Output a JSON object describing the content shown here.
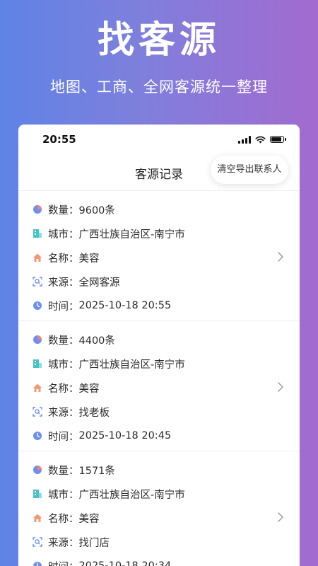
{
  "hero": {
    "title": "找客源",
    "subtitle": "地图、工商、全网客源统一整理"
  },
  "status": {
    "time": "20:55"
  },
  "nav": {
    "title": "客源记录",
    "clear_export_label": "清空导出联系人"
  },
  "labels": {
    "count": "数量：",
    "city": "城市：",
    "name": "名称：",
    "source": "来源：",
    "time": "时间："
  },
  "records": [
    {
      "count": "9600条",
      "city": "广西壮族自治区-南宁市",
      "name": "美容",
      "source": "全网客源",
      "time": "2025-10-18 20:55"
    },
    {
      "count": "4400条",
      "city": "广西壮族自治区-南宁市",
      "name": "美容",
      "source": "找老板",
      "time": "2025-10-18 20:45"
    },
    {
      "count": "1571条",
      "city": "广西壮族自治区-南宁市",
      "name": "美容",
      "source": "找门店",
      "time": "2025-10-18 20:34"
    }
  ],
  "icons": {
    "count": "pie-chart-icon",
    "city": "building-icon",
    "name": "home-icon",
    "source": "scan-icon",
    "time": "clock-icon",
    "chevron": "chevron-right-icon"
  },
  "colors": {
    "accent_blue": "#5f83e6",
    "accent_purple": "#a36ad0",
    "pie_blue": "#6f8ff0",
    "pie_red": "#f08080",
    "building_teal": "#43c4c8",
    "home_orange": "#f29a74",
    "scan_blue": "#6f8ff0",
    "clock_blue": "#6f8ff0"
  }
}
